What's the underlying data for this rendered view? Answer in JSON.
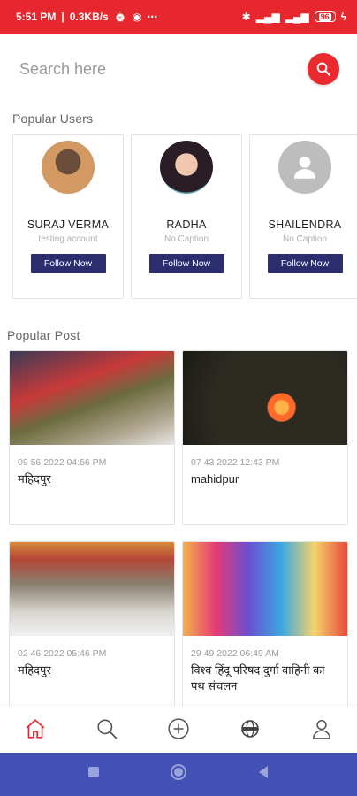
{
  "status_bar": {
    "time": "5:51 PM",
    "speed": "0.3KB/s",
    "battery": "96"
  },
  "search": {
    "placeholder": "Search here"
  },
  "popular_users": {
    "title": "Popular Users",
    "follow_label": "Follow Now",
    "users": [
      {
        "name": "SURAJ VERMA",
        "caption": "testing account"
      },
      {
        "name": "RADHA",
        "caption": "No Caption"
      },
      {
        "name": "SHAILENDRA",
        "caption": "No Caption"
      }
    ]
  },
  "popular_post": {
    "title": "Popular Post",
    "posts": [
      {
        "date": "09 56 2022 04:56 PM",
        "title": "महिदपुर"
      },
      {
        "date": "07 43 2022 12:43 PM",
        "title": "mahidpur"
      },
      {
        "date": "02 46 2022 05:46 PM",
        "title": "महिदपुर"
      },
      {
        "date": "29 49 2022 06:49 AM",
        "title": "विश्व हिंदू परिषद दुर्गा वाहिनी का पथ संचलन"
      }
    ]
  },
  "colors": {
    "status_bar": "#e8262d",
    "accent": "#ea2a2f",
    "follow_button": "#2b2d6e",
    "system_nav": "#4351b4"
  },
  "bottom_nav": [
    "home-icon",
    "search-icon",
    "add-icon",
    "globe-icon",
    "profile-icon"
  ]
}
